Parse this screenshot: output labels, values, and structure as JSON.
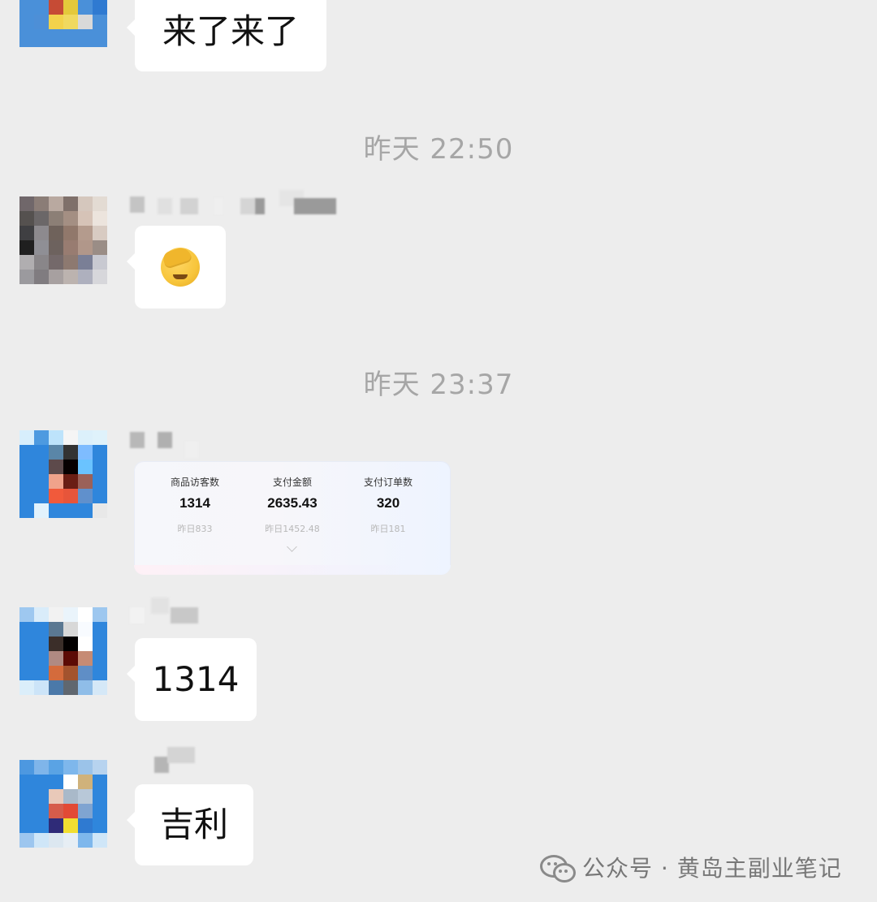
{
  "chat": {
    "messages": [
      {
        "text": "来了来了"
      },
      {
        "timestamp": "昨天 22:50"
      },
      {
        "emoji": "facepalm-emoji"
      },
      {
        "timestamp": "昨天 23:37"
      },
      {
        "card": {
          "metrics": [
            {
              "label": "商品访客数",
              "value": "1314",
              "yesterday": "昨日833"
            },
            {
              "label": "支付金额",
              "value": "2635.43",
              "yesterday": "昨日1452.48"
            },
            {
              "label": "支付订单数",
              "value": "320",
              "yesterday": "昨日181"
            }
          ]
        }
      },
      {
        "text": "1314"
      },
      {
        "text": "吉利"
      }
    ]
  },
  "watermark": {
    "text": "公众号 · 黄岛主副业笔记",
    "icon": "wechat-icon"
  }
}
